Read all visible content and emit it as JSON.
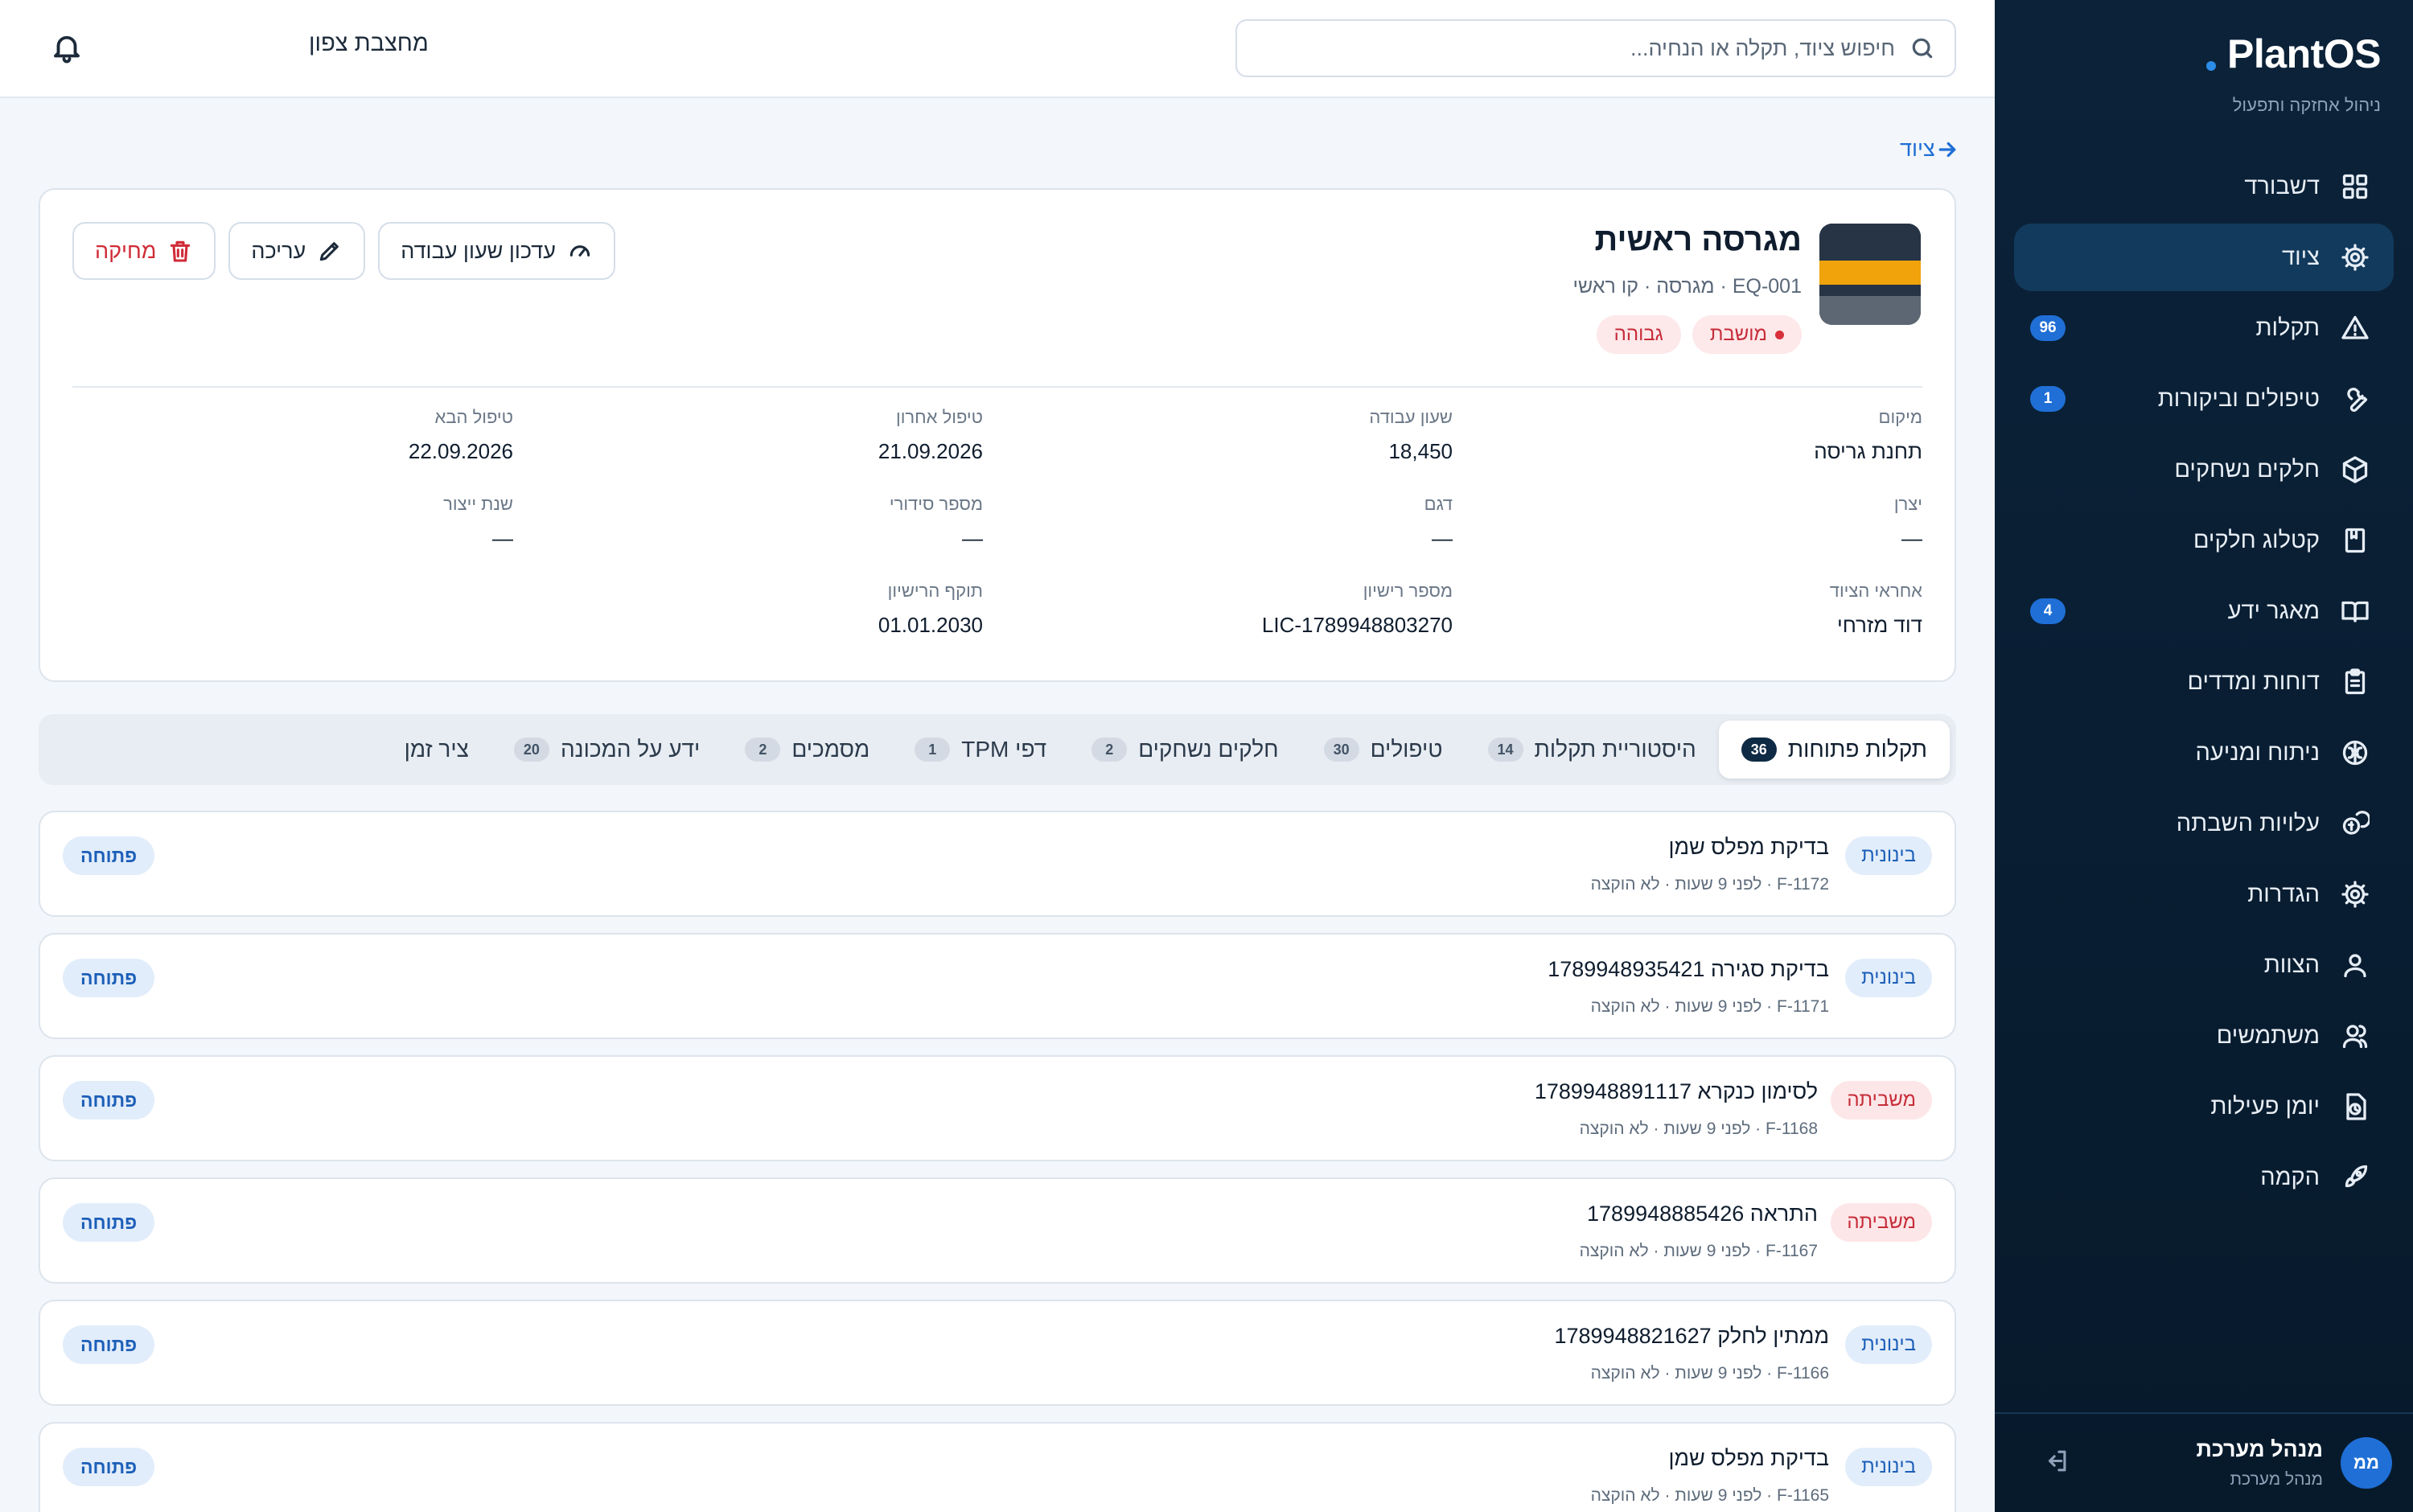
{
  "app": {
    "brand": "PlantOS",
    "tagline": "ניהול אחזקה ותפעול"
  },
  "sidebar": {
    "items": [
      {
        "label": "דשבורד",
        "icon": "grid-icon",
        "badge": ""
      },
      {
        "label": "ציוד",
        "icon": "gear-icon",
        "badge": "",
        "active": true
      },
      {
        "label": "תקלות",
        "icon": "warning-icon",
        "badge": "96"
      },
      {
        "label": "טיפולים וביקורות",
        "icon": "wrench-icon",
        "badge": "1"
      },
      {
        "label": "חלקים נשחקים",
        "icon": "box-icon",
        "badge": ""
      },
      {
        "label": "קטלוג חלקים",
        "icon": "book-icon",
        "badge": ""
      },
      {
        "label": "מאגר ידע",
        "icon": "open-book-icon",
        "badge": "4"
      },
      {
        "label": "דוחות ומדדים",
        "icon": "clipboard-icon",
        "badge": ""
      },
      {
        "label": "ניתוח ומניעה",
        "icon": "brain-icon",
        "badge": ""
      },
      {
        "label": "עלויות השבתה",
        "icon": "coins-icon",
        "badge": ""
      },
      {
        "label": "הגדרות",
        "icon": "settings-icon",
        "badge": ""
      },
      {
        "label": "הצוות",
        "icon": "user-icon",
        "badge": ""
      },
      {
        "label": "משתמשים",
        "icon": "users-icon",
        "badge": ""
      },
      {
        "label": "יומן פעילות",
        "icon": "log-icon",
        "badge": ""
      },
      {
        "label": "הקמה",
        "icon": "rocket-icon",
        "badge": ""
      }
    ],
    "user": {
      "initials": "ממ",
      "name": "מנהל מערכת",
      "role": "מנהל מערכת"
    }
  },
  "topbar": {
    "search_placeholder": "חיפוש ציוד, תקלה או הנחיה...",
    "site_name": "מחצבת צפון"
  },
  "breadcrumb": {
    "label": "ציוד"
  },
  "equipment": {
    "title": "מגרסה ראשית",
    "meta": "EQ-001 · מגרסה · קו ראשי",
    "status_badge": "מושבת",
    "priority_badge": "גבוהה",
    "actions": {
      "update_hours": "עדכון שעון עבודה",
      "edit": "עריכה",
      "delete": "מחיקה"
    },
    "details": [
      {
        "label": "מיקום",
        "value": "תחנת גריסה"
      },
      {
        "label": "שעון עבודה",
        "value": "18,450"
      },
      {
        "label": "טיפול אחרון",
        "value": "21.09.2026"
      },
      {
        "label": "טיפול הבא",
        "value": "22.09.2026"
      },
      {
        "label": "יצרן",
        "value": "—"
      },
      {
        "label": "דגם",
        "value": "—"
      },
      {
        "label": "מספר סידורי",
        "value": "—"
      },
      {
        "label": "שנת ייצור",
        "value": "—"
      },
      {
        "label": "אחראי הציוד",
        "value": "דוד מזרחי"
      },
      {
        "label": "מספר רישיון",
        "value": "LIC-1789948803270"
      },
      {
        "label": "תוקף הרישיון",
        "value": "01.01.2030"
      }
    ]
  },
  "tabs": [
    {
      "label": "תקלות פתוחות",
      "count": "36",
      "active": true
    },
    {
      "label": "היסטוריית תקלות",
      "count": "14"
    },
    {
      "label": "טיפולים",
      "count": "30"
    },
    {
      "label": "חלקים נשחקים",
      "count": "2"
    },
    {
      "label": "דפי TPM",
      "count": "1"
    },
    {
      "label": "מסמכים",
      "count": "2"
    },
    {
      "label": "ידע על המכונה",
      "count": "20"
    },
    {
      "label": "ציר זמן",
      "count": ""
    }
  ],
  "faults": [
    {
      "severity": "בינונית",
      "level": "mid",
      "title": "בדיקת מפלס שמן",
      "meta": "F-1172 · לפני 9 שעות · לא הוקצה",
      "status": "פתוחה"
    },
    {
      "severity": "בינונית",
      "level": "mid",
      "title": "בדיקת סגירה 1789948935421",
      "meta": "F-1171 · לפני 9 שעות · לא הוקצה",
      "status": "פתוחה"
    },
    {
      "severity": "משביתה",
      "level": "hi",
      "title": "לסימון כנקרא 1789948891117",
      "meta": "F-1168 · לפני 9 שעות · לא הוקצה",
      "status": "פתוחה"
    },
    {
      "severity": "משביתה",
      "level": "hi",
      "title": "התראה 1789948885426",
      "meta": "F-1167 · לפני 9 שעות · לא הוקצה",
      "status": "פתוחה"
    },
    {
      "severity": "בינונית",
      "level": "mid",
      "title": "ממתין לחלק 1789948821627",
      "meta": "F-1166 · לפני 9 שעות · לא הוקצה",
      "status": "פתוחה"
    },
    {
      "severity": "בינונית",
      "level": "mid",
      "title": "בדיקת מפלס שמן",
      "meta": "F-1165 · לפני 9 שעות · לא הוקצה",
      "status": "פתוחה"
    }
  ],
  "colors": {
    "sidebar_bg": "#0b2239",
    "accent": "#1f6fd6",
    "danger": "#d02b37"
  }
}
